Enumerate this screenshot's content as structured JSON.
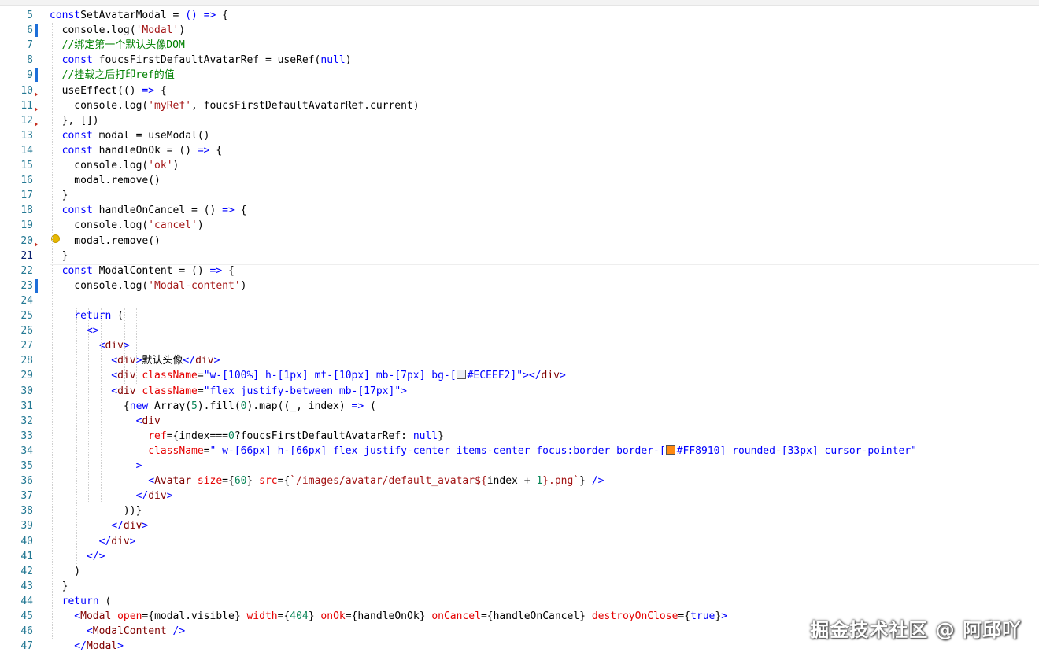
{
  "editor": {
    "line_numbers": [
      "5",
      "6",
      "7",
      "8",
      "9",
      "10",
      "11",
      "12",
      "13",
      "14",
      "15",
      "16",
      "17",
      "18",
      "19",
      "20",
      "21",
      "22",
      "23",
      "24",
      "25",
      "26",
      "27",
      "28",
      "29",
      "30",
      "31",
      "32",
      "33",
      "34",
      "35",
      "36",
      "37",
      "38",
      "39",
      "40",
      "41",
      "42",
      "43",
      "44",
      "45",
      "46",
      "47"
    ],
    "active_line": "21",
    "lines": [
      [
        [
          "k",
          "const"
        ],
        [
          "",
          "SetAvatarModal"
        ],
        [
          "",
          " = "
        ],
        [
          "k",
          "()"
        ],
        [
          "",
          " "
        ],
        [
          "k",
          "=>"
        ],
        [
          "",
          " {"
        ]
      ],
      [
        [
          "",
          "  console.log("
        ],
        [
          "s",
          "'Modal'"
        ],
        [
          "",
          ")"
        ]
      ],
      [
        [
          "c",
          "  //绑定第一个默认头像DOM"
        ]
      ],
      [
        [
          "k",
          "  const"
        ],
        [
          "",
          " foucsFirstDefaultAvatarRef = useRef("
        ],
        [
          "k",
          "null"
        ],
        [
          "",
          ")"
        ]
      ],
      [
        [
          "c",
          "  //挂载之后打印ref的值"
        ]
      ],
      [
        [
          "",
          "  useEffect(() "
        ],
        [
          "k",
          "=>"
        ],
        [
          "",
          " {"
        ]
      ],
      [
        [
          "",
          "    console.log("
        ],
        [
          "s",
          "'myRef'"
        ],
        [
          "",
          ", foucsFirstDefaultAvatarRef.current)"
        ]
      ],
      [
        [
          "",
          "  }, [])"
        ]
      ],
      [
        [
          "k",
          "  const"
        ],
        [
          "",
          " modal = useModal()"
        ]
      ],
      [
        [
          "k",
          "  const"
        ],
        [
          "",
          " handleOnOk = () "
        ],
        [
          "k",
          "=>"
        ],
        [
          "",
          " {"
        ]
      ],
      [
        [
          "",
          "    console.log("
        ],
        [
          "s",
          "'ok'"
        ],
        [
          "",
          ")"
        ]
      ],
      [
        [
          "",
          "    modal.remove()"
        ]
      ],
      [
        [
          "",
          "  }"
        ]
      ],
      [
        [
          "k",
          "  const"
        ],
        [
          "",
          " handleOnCancel = () "
        ],
        [
          "k",
          "=>"
        ],
        [
          "",
          " {"
        ]
      ],
      [
        [
          "",
          "    console.log("
        ],
        [
          "s",
          "'cancel'"
        ],
        [
          "",
          ")"
        ]
      ],
      [
        [
          "",
          "    modal.remove()"
        ]
      ],
      [
        [
          "",
          "  }"
        ]
      ],
      [
        [
          "k",
          "  const"
        ],
        [
          "",
          " ModalContent = () "
        ],
        [
          "k",
          "=>"
        ],
        [
          "",
          " {"
        ]
      ],
      [
        [
          "",
          "    console.log("
        ],
        [
          "s",
          "'Modal-content'"
        ],
        [
          "",
          ")"
        ]
      ],
      [
        [
          "",
          ""
        ]
      ],
      [
        [
          "k",
          "    return"
        ],
        [
          "",
          " ("
        ]
      ],
      [
        [
          "k",
          "      <>"
        ]
      ],
      [
        [
          "k",
          "        <"
        ],
        [
          "t",
          "div"
        ],
        [
          "k",
          ">"
        ]
      ],
      [
        [
          "k",
          "          <"
        ],
        [
          "t",
          "div"
        ],
        [
          "k",
          ">"
        ],
        [
          "",
          "默认头像"
        ],
        [
          "k",
          "</"
        ],
        [
          "t",
          "div"
        ],
        [
          "k",
          ">"
        ]
      ],
      [
        [
          "k",
          "          <"
        ],
        [
          "t",
          "div"
        ],
        [
          "",
          " "
        ],
        [
          "a",
          "className"
        ],
        [
          "",
          "="
        ],
        [
          "k",
          "\"w-[100%] h-[1px] mt-[10px] mb-[7px] bg-["
        ],
        [
          "sw",
          "#ECEEF2"
        ],
        [
          "k",
          "#ECEEF2]\""
        ],
        [
          "k",
          "></"
        ],
        [
          "t",
          "div"
        ],
        [
          "k",
          ">"
        ]
      ],
      [
        [
          "k",
          "          <"
        ],
        [
          "t",
          "div"
        ],
        [
          "",
          " "
        ],
        [
          "a",
          "className"
        ],
        [
          "",
          "="
        ],
        [
          "k",
          "\"flex justify-between mb-[17px]\""
        ],
        [
          "k",
          ">"
        ]
      ],
      [
        [
          "",
          "            {"
        ],
        [
          "k",
          "new"
        ],
        [
          "",
          " Array("
        ],
        [
          "n",
          "5"
        ],
        [
          "",
          ").fill("
        ],
        [
          "n",
          "0"
        ],
        [
          "",
          ").map((_, index) "
        ],
        [
          "k",
          "=>"
        ],
        [
          "",
          " ("
        ]
      ],
      [
        [
          "k",
          "              <"
        ],
        [
          "t",
          "div"
        ]
      ],
      [
        [
          "",
          "                "
        ],
        [
          "a",
          "ref"
        ],
        [
          "",
          "={index==="
        ],
        [
          "n",
          "0"
        ],
        [
          "",
          "?foucsFirstDefaultAvatarRef: "
        ],
        [
          "k",
          "null"
        ],
        [
          "",
          "}"
        ]
      ],
      [
        [
          "",
          "                "
        ],
        [
          "a",
          "className"
        ],
        [
          "",
          "="
        ],
        [
          "k",
          "\" w-[66px] h-[66px] flex justify-center items-center focus:border border-["
        ],
        [
          "sw",
          "#FF8910"
        ],
        [
          "k",
          "#FF8910] rounded-[33px] cursor-pointer\""
        ]
      ],
      [
        [
          "k",
          "              >"
        ]
      ],
      [
        [
          "k",
          "                <"
        ],
        [
          "t",
          "Avatar"
        ],
        [
          "",
          " "
        ],
        [
          "a",
          "size"
        ],
        [
          "",
          "={"
        ],
        [
          "n",
          "60"
        ],
        [
          "",
          "} "
        ],
        [
          "a",
          "src"
        ],
        [
          "",
          "={"
        ],
        [
          "s",
          "`/images/avatar/default_avatar${"
        ],
        [
          "",
          "index + "
        ],
        [
          "n",
          "1"
        ],
        [
          "s",
          "}.png`"
        ],
        [
          "",
          "} "
        ],
        [
          "k",
          "/>"
        ]
      ],
      [
        [
          "k",
          "              </"
        ],
        [
          "t",
          "div"
        ],
        [
          "k",
          ">"
        ]
      ],
      [
        [
          "",
          "            ))}"
        ]
      ],
      [
        [
          "k",
          "          </"
        ],
        [
          "t",
          "div"
        ],
        [
          "k",
          ">"
        ]
      ],
      [
        [
          "k",
          "        </"
        ],
        [
          "t",
          "div"
        ],
        [
          "k",
          ">"
        ]
      ],
      [
        [
          "k",
          "      </>"
        ]
      ],
      [
        [
          "",
          "    )"
        ]
      ],
      [
        [
          "",
          "  }"
        ]
      ],
      [
        [
          "k",
          "  return"
        ],
        [
          "",
          " ("
        ]
      ],
      [
        [
          "k",
          "    <"
        ],
        [
          "t",
          "Modal"
        ],
        [
          "",
          " "
        ],
        [
          "a",
          "open"
        ],
        [
          "",
          "={modal.visible} "
        ],
        [
          "a",
          "width"
        ],
        [
          "",
          "={"
        ],
        [
          "n",
          "404"
        ],
        [
          "",
          "} "
        ],
        [
          "a",
          "onOk"
        ],
        [
          "",
          "={handleOnOk} "
        ],
        [
          "a",
          "onCancel"
        ],
        [
          "",
          "={handleOnCancel} "
        ],
        [
          "a",
          "destroyOnClose"
        ],
        [
          "",
          "={"
        ],
        [
          "k",
          "true"
        ],
        [
          "",
          "}"
        ],
        [
          "k",
          ">"
        ]
      ],
      [
        [
          "k",
          "      <"
        ],
        [
          "t",
          "ModalContent"
        ],
        [
          "",
          " "
        ],
        [
          "k",
          "/>"
        ]
      ],
      [
        [
          "k",
          "    </"
        ],
        [
          "t",
          "Modal"
        ],
        [
          "k",
          ">"
        ]
      ]
    ]
  },
  "watermark": "掘金技术社区 @ 阿邱吖",
  "colors": {
    "keyword": "#0000ff",
    "string": "#a31515",
    "comment": "#008000",
    "number": "#098658",
    "tag": "#800000",
    "attribute": "#e50000",
    "line_number": "#237893"
  }
}
